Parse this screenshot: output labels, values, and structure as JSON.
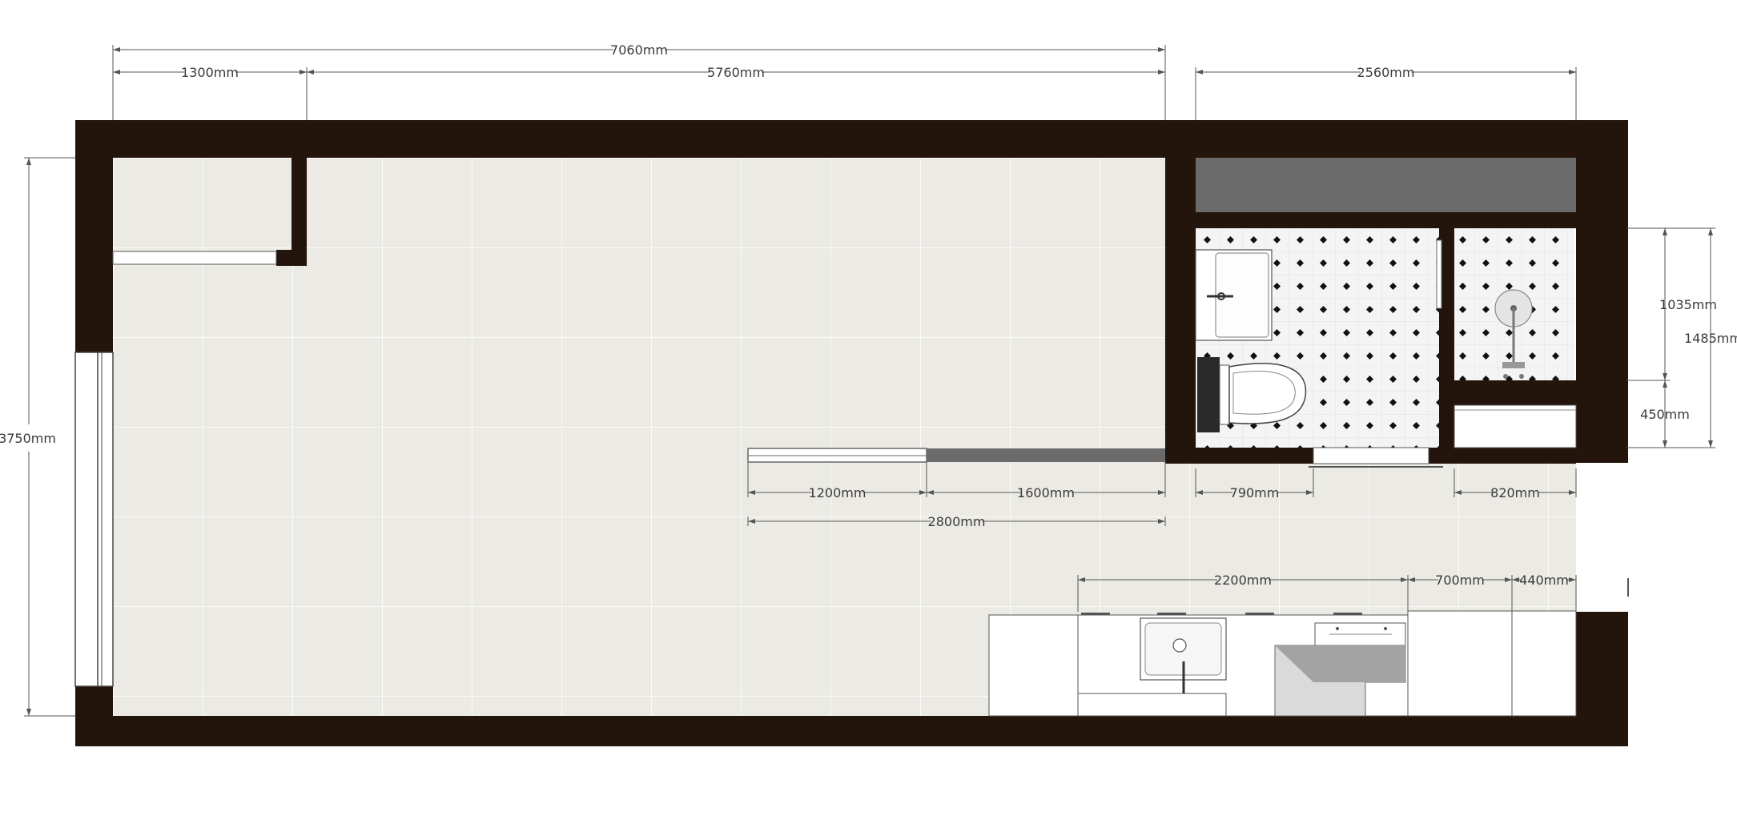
{
  "plan_title": "",
  "colors": {
    "wall": "#24150c",
    "floor": "#ebeae4",
    "floor_grid": "#f9f9f6",
    "dimension_line": "#555555",
    "dimension_text": "#3a3a3a",
    "bathroom_tile_dot": "#111111",
    "shelf_grey": "#6b6b6b"
  },
  "dimensions": {
    "overall_width": "7060mm",
    "entry_closet_width": "1300mm",
    "main_room_width": "5760mm",
    "bathroom_width": "2560mm",
    "room_depth": "3750mm",
    "shower_depth": "1035mm",
    "bathroom_depth": "1485mm",
    "closet_depth": "450mm",
    "partition_glass": "1200mm",
    "partition_solid": "1600mm",
    "partition_total": "2800mm",
    "bathroom_door": "790mm",
    "wardrobe_width": "820mm",
    "kitchen_counter": "2200mm",
    "fridge_width": "700mm",
    "cabinet_width": "440mm"
  },
  "fixtures": [
    "washbasin",
    "toilet",
    "shower",
    "kitchen-sink",
    "cooktop",
    "refrigerator",
    "wardrobe",
    "window",
    "entrance-door"
  ]
}
